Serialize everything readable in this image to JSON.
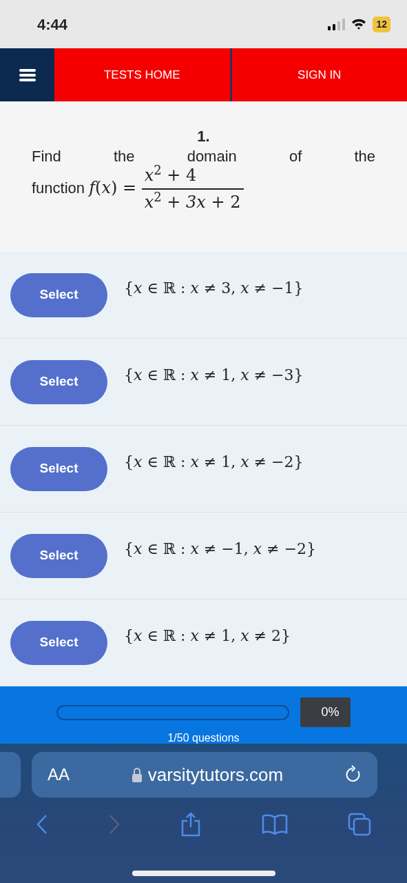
{
  "status_bar": {
    "time": "4:44",
    "battery": "12"
  },
  "nav": {
    "items": [
      {
        "label": "TESTS HOME"
      },
      {
        "label": "SIGN IN"
      }
    ]
  },
  "question": {
    "number": "1.",
    "prompt": "Find the domain of the function",
    "lhs": "*f*(*x*) =",
    "numerator": "*x*$^{2}$ + 4",
    "denominator": "*x*$^{2}$ + *3x* + 2"
  },
  "options": [
    {
      "button": "Select",
      "selected": false,
      "text": "{*x* ∈ ℝ : *x* ≠ 3, *x* ≠ −1}"
    },
    {
      "button": "Select",
      "selected": false,
      "text": "{*x* ∈ ℝ : *x* ≠ 1, *x* ≠ −3}"
    },
    {
      "button": "Select",
      "selected": false,
      "text": "{*x* ∈ ℝ : *x* ≠ 1, *x* ≠ −2}"
    },
    {
      "button": "Select",
      "selected": false,
      "text": "{*x* ∈ ℝ : *x* ≠ −1, *x* ≠ −2}"
    },
    {
      "button": "Select",
      "selected": false,
      "text": "{*x* ∈ ℝ : *x* ≠ 1, *x* ≠ 2}"
    }
  ],
  "progress": {
    "level": 0,
    "reading": "0%",
    "caption": "1/50 questions"
  },
  "browser": {
    "text_size": "AA",
    "url": "varsitytutors.com"
  }
}
